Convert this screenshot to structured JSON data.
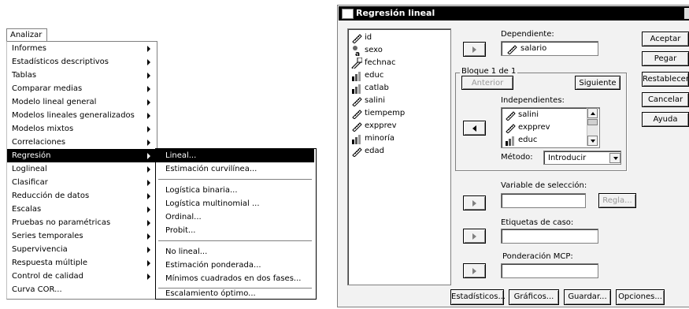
{
  "analyze_menu": {
    "title": "Analizar",
    "items": [
      {
        "label": "Informes",
        "submenu": true
      },
      {
        "label": "Estadísticos descriptivos",
        "submenu": true
      },
      {
        "label": "Tablas",
        "submenu": true
      },
      {
        "label": "Comparar medias",
        "submenu": true
      },
      {
        "label": "Modelo lineal general",
        "submenu": true
      },
      {
        "label": "Modelos lineales generalizados",
        "submenu": true
      },
      {
        "label": "Modelos mixtos",
        "submenu": true
      },
      {
        "label": "Correlaciones",
        "submenu": true
      },
      {
        "label": "Regresión",
        "submenu": true,
        "selected": true
      },
      {
        "label": "Loglineal",
        "submenu": true
      },
      {
        "label": "Clasificar",
        "submenu": true
      },
      {
        "label": "Reducción de datos",
        "submenu": true
      },
      {
        "label": "Escalas",
        "submenu": true
      },
      {
        "label": "Pruebas no paramétricas",
        "submenu": true
      },
      {
        "label": "Series temporales",
        "submenu": true
      },
      {
        "label": "Supervivencia",
        "submenu": true
      },
      {
        "label": "Respuesta múltiple",
        "submenu": true
      },
      {
        "label": "Control de calidad",
        "submenu": true
      },
      {
        "label": "Curva COR...",
        "submenu": false
      }
    ]
  },
  "regression_submenu": {
    "items": [
      {
        "label": "Lineal...",
        "selected": true
      },
      {
        "label": "Estimación curvilínea..."
      },
      {
        "label": "Logística binaria..."
      },
      {
        "label": "Logística multinomial ..."
      },
      {
        "label": "Ordinal..."
      },
      {
        "label": "Probit..."
      },
      {
        "label": "No lineal..."
      },
      {
        "label": "Estimación ponderada..."
      },
      {
        "label": "Mínimos cuadrados en dos fases..."
      },
      {
        "label": "Escalamiento óptimo..."
      }
    ]
  },
  "dialog": {
    "title": "Regresión lineal",
    "variables": [
      {
        "name": "id",
        "icon": "scale-variable-icon"
      },
      {
        "name": "sexo",
        "icon": "string-variable-icon"
      },
      {
        "name": "fechnac",
        "icon": "date-variable-icon"
      },
      {
        "name": "educ",
        "icon": "ordinal-variable-icon"
      },
      {
        "name": "catlab",
        "icon": "ordinal-variable-icon"
      },
      {
        "name": "salini",
        "icon": "scale-variable-icon"
      },
      {
        "name": "tiempemp",
        "icon": "scale-variable-icon"
      },
      {
        "name": "expprev",
        "icon": "scale-variable-icon"
      },
      {
        "name": "minoría",
        "icon": "ordinal-variable-icon"
      },
      {
        "name": "edad",
        "icon": "scale-variable-icon"
      }
    ],
    "dependent_label": "Dependiente:",
    "dependent_value": "salario",
    "block_label": "Bloque 1 de 1",
    "previous_label": "Anterior",
    "next_label": "Siguiente",
    "independents_label": "Independientes:",
    "independents": [
      {
        "name": "salini",
        "icon": "scale-variable-icon"
      },
      {
        "name": "expprev",
        "icon": "scale-variable-icon"
      },
      {
        "name": "educ",
        "icon": "ordinal-variable-icon"
      }
    ],
    "method_label": "Método:",
    "method_value": "Introducir",
    "selection_variable_label": "Variable de selección:",
    "rule_label": "Regla...",
    "case_labels_label": "Etiquetas de caso:",
    "wls_weight_label": "Ponderación MCP:",
    "side_buttons": {
      "ok": "Aceptar",
      "paste": "Pegar",
      "reset": "Restablecer",
      "cancel": "Cancelar",
      "help": "Ayuda"
    },
    "bottom_buttons": {
      "statistics": "Estadísticos...",
      "plots": "Gráficos...",
      "save": "Guardar...",
      "options": "Opciones..."
    }
  }
}
